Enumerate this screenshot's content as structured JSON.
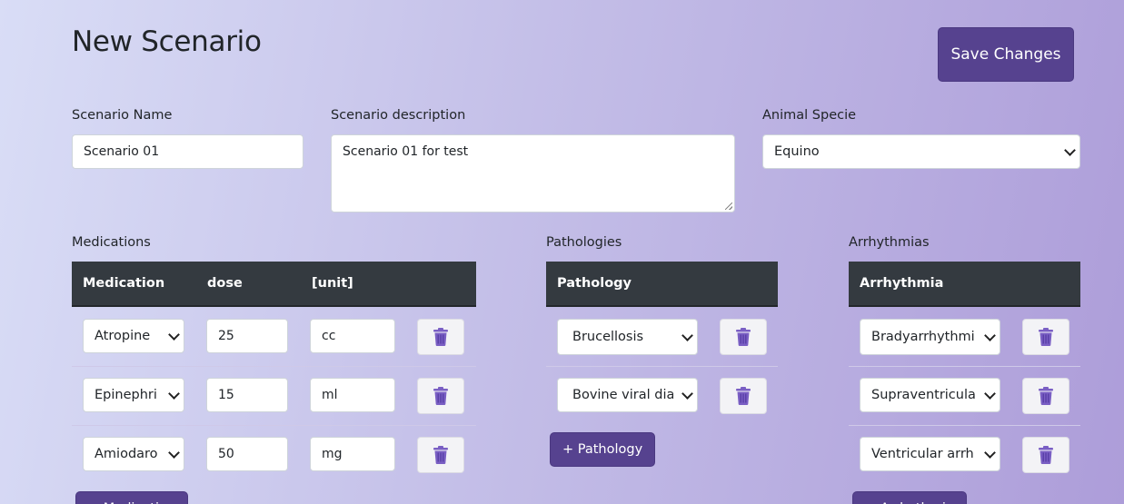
{
  "page": {
    "title": "New Scenario"
  },
  "toolbar": {
    "save_label": "Save Changes"
  },
  "form": {
    "name_label": "Scenario Name",
    "name_value": "Scenario 01",
    "description_label": "Scenario description",
    "description_value": "Scenario 01 for test",
    "species_label": "Animal Specie",
    "species_value": "Equino"
  },
  "medications": {
    "section_label": "Medications",
    "headers": [
      "Medication",
      "dose",
      "[unit]"
    ],
    "rows": [
      {
        "medication": "Atropine",
        "dose": "25",
        "unit": "cc"
      },
      {
        "medication": "Epinephri",
        "dose": "15",
        "unit": "ml"
      },
      {
        "medication": "Amiodaro",
        "dose": "50",
        "unit": "mg"
      }
    ],
    "add_label": "+ Medication"
  },
  "pathologies": {
    "section_label": "Pathologies",
    "header": "Pathology",
    "rows": [
      {
        "value": "Brucellosis"
      },
      {
        "value": "Bovine viral diar"
      }
    ],
    "add_label": "+ Pathology"
  },
  "arrhythmias": {
    "section_label": "Arrhythmias",
    "header": "Arrhythmia",
    "rows": [
      {
        "value": "Bradyarrhythmi"
      },
      {
        "value": "Supraventricula"
      },
      {
        "value": "Ventricular arrh"
      }
    ],
    "add_label": "+ Arrhythmia"
  },
  "icons": {
    "delete": "trash-icon"
  },
  "colors": {
    "primary": "#56428f",
    "table_header": "#343a40",
    "trash": "#7a5fc4"
  }
}
